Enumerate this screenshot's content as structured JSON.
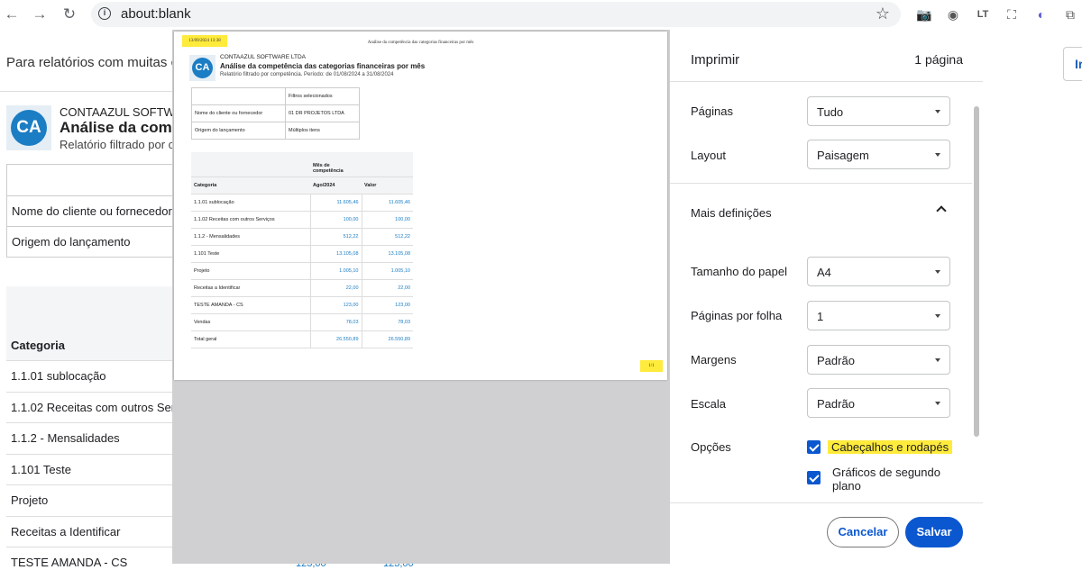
{
  "browser": {
    "url": "about:blank"
  },
  "background_page": {
    "notice": "Para relatórios com muitas co",
    "company": "CONTAAZUL SOFTWARE",
    "title": "Análise da compe",
    "subtitle": "Relatório filtrado por c",
    "logo_text": "CA",
    "filter_rows": [
      "Nome do cliente ou fornecedor",
      "Origem do lançamento"
    ],
    "table_header": "Categoria",
    "rows": [
      "1.1.01 sublocação",
      "1.1.02 Receitas com outros Servi",
      "1.1.2 - Mensalidades",
      "1.101 Teste",
      "Projeto",
      "Receitas a Identificar",
      "TESTE AMANDA - CS"
    ],
    "stray_values": [
      "123,00",
      "123,00"
    ],
    "right_button": "Ir"
  },
  "preview_sheet": {
    "header_left": "13/09/2024  13:38",
    "header_center": "Análise da competência das categorias financeiras por mês",
    "footer_right": "1/1",
    "company": "CONTAAZUL SOFTWARE LTDA",
    "title": "Análise da competência das categorias financeiras por mês",
    "subtitle": "Relatório filtrado por competência. Período: de 01/08/2024 a 31/08/2024",
    "logo_text": "CA",
    "filters_header": "Filtros selecionados",
    "filters": [
      {
        "label": "Nome do cliente ou fornecedor",
        "value": "01 DR PROJETOS LTDA"
      },
      {
        "label": "Origem do lançamento",
        "value": "Múltiplos itens"
      }
    ],
    "table": {
      "group_header": "Mês de competência",
      "col_category": "Categoria",
      "col_month": "Ago/2024",
      "col_value": "Valor",
      "rows": [
        {
          "category": "1.1.01 sublocação",
          "month": "11.605,46",
          "value": "11.605,46"
        },
        {
          "category": "1.1.02 Receitas com outros Serviços",
          "month": "100,00",
          "value": "100,00"
        },
        {
          "category": "1.1.2 - Mensalidades",
          "month": "512,22",
          "value": "512,22"
        },
        {
          "category": "1.101 Teste",
          "month": "13.105,08",
          "value": "13.105,08"
        },
        {
          "category": "Projeto",
          "month": "1.005,10",
          "value": "1.005,10"
        },
        {
          "category": "Receitas a Identificar",
          "month": "22,00",
          "value": "22,00"
        },
        {
          "category": "TESTE AMANDA - CS",
          "month": "123,00",
          "value": "123,00"
        },
        {
          "category": "Vendas",
          "month": "78,03",
          "value": "78,03"
        },
        {
          "category": "Total geral",
          "month": "26.550,89",
          "value": "26.550,89"
        }
      ]
    }
  },
  "print_dialog": {
    "title": "Imprimir",
    "page_count": "1 página",
    "pages_label": "Páginas",
    "pages_value": "Tudo",
    "layout_label": "Layout",
    "layout_value": "Paisagem",
    "more_settings": "Mais definições",
    "paper_label": "Tamanho do papel",
    "paper_value": "A4",
    "per_sheet_label": "Páginas por folha",
    "per_sheet_value": "1",
    "margins_label": "Margens",
    "margins_value": "Padrão",
    "scale_label": "Escala",
    "scale_value": "Padrão",
    "options_label": "Opções",
    "option_headers": "Cabeçalhos e rodapés",
    "option_graphics_line1": "Gráficos de segundo",
    "option_graphics_line2": "plano",
    "cancel": "Cancelar",
    "save": "Salvar"
  },
  "colors": {
    "accent": "#0b57d0",
    "highlight": "#ffeb3b",
    "brand": "#1b7dc4"
  }
}
